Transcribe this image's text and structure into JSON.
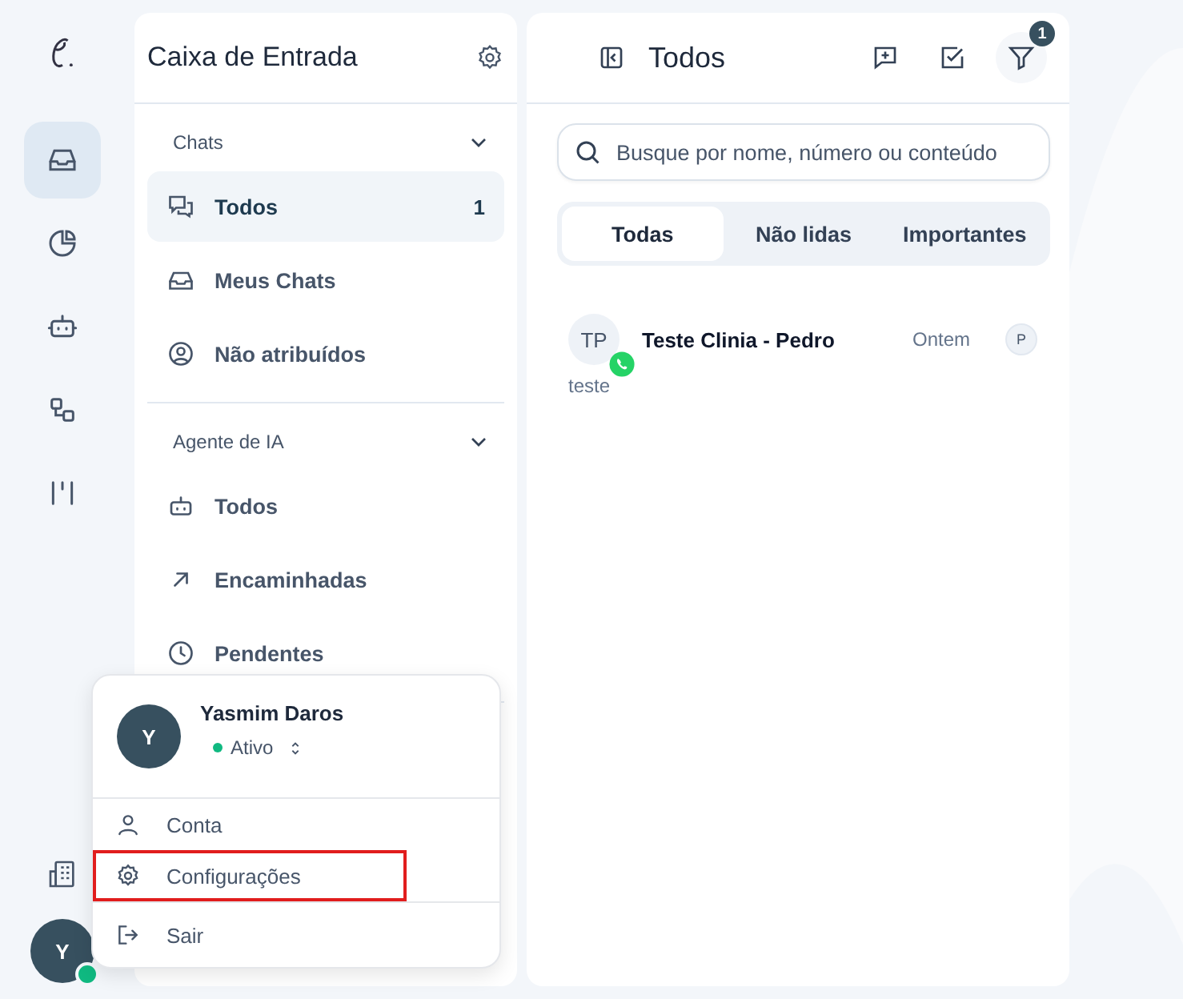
{
  "rail": {
    "items": [
      {
        "kind": "inbox",
        "selected": true
      },
      {
        "kind": "chart",
        "selected": false
      },
      {
        "kind": "bot",
        "selected": false
      },
      {
        "kind": "flow",
        "selected": false
      },
      {
        "kind": "columns",
        "selected": false
      }
    ],
    "user_avatar": {
      "initial": "Y",
      "online": true
    }
  },
  "inbox": {
    "title": "Caixa de Entrada",
    "sections": [
      {
        "label": "Chats",
        "expanded": true,
        "items": [
          {
            "kind": "chats",
            "label": "Todos",
            "count": "1",
            "selected": true
          },
          {
            "kind": "inbox",
            "label": "Meus Chats",
            "selected": false
          },
          {
            "kind": "user",
            "label": "Não atribuídos",
            "selected": false
          }
        ]
      },
      {
        "label": "Agente de IA",
        "expanded": true,
        "items": [
          {
            "kind": "bot",
            "label": "Todos",
            "selected": false
          },
          {
            "kind": "arrow",
            "label": "Encaminhadas",
            "selected": false
          },
          {
            "kind": "clock",
            "label": "Pendentes",
            "selected": false
          }
        ]
      }
    ]
  },
  "list": {
    "title": "Todos",
    "filter_badge": "1",
    "search": {
      "placeholder": "Busque por nome, número ou conteúdo"
    },
    "tabs": [
      {
        "label": "Todas",
        "selected": true
      },
      {
        "label": "Não lidas",
        "selected": false
      },
      {
        "label": "Importantes",
        "selected": false
      }
    ],
    "conversations": [
      {
        "initials": "TP",
        "name": "Teste Clinia - Pedro",
        "time": "Ontem",
        "agent": "P",
        "preview": "teste"
      }
    ]
  },
  "user_menu": {
    "initial": "Y",
    "name": "Yasmim Daros",
    "status": "Ativo",
    "items": [
      {
        "kind": "user",
        "label": "Conta",
        "highlighted": false
      },
      {
        "kind": "gear",
        "label": "Configurações",
        "highlighted": true
      },
      {
        "kind": "logout",
        "label": "Sair",
        "highlighted": false
      }
    ]
  }
}
